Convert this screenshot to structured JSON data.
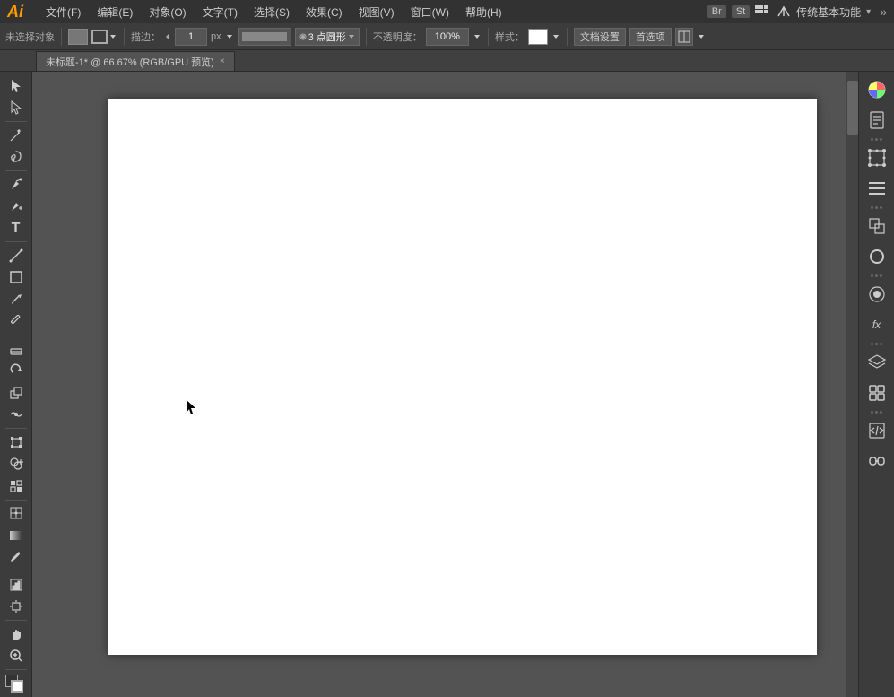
{
  "titlebar": {
    "logo": "Ai",
    "menus": [
      "文件(F)",
      "编辑(E)",
      "对象(O)",
      "文字(T)",
      "选择(S)",
      "效果(C)",
      "视图(V)",
      "窗口(W)",
      "帮助(H)"
    ],
    "bridge_label": "Br",
    "stock_label": "St",
    "workspace_label": "传统基本功能",
    "workspace_arrow": "▾"
  },
  "optionsbar": {
    "no_selection_label": "未选择对象",
    "stroke_label": "描边：",
    "stroke_value": "1",
    "stroke_unit": "px",
    "stroke_dropdown": "3 点圆形",
    "opacity_label": "不透明度：",
    "opacity_value": "100%",
    "style_label": "样式：",
    "doc_settings_label": "文档设置",
    "preferences_label": "首选项"
  },
  "tabbar": {
    "tab_label": "未标题-1* @ 66.67% (RGB/GPU 预览)",
    "close": "×"
  },
  "tools": {
    "selection": "▶",
    "direct_selection": "▷",
    "magic_wand": "✦",
    "lasso": "⌇",
    "pen": "✒",
    "add_anchor": "+",
    "remove_anchor": "−",
    "anchor_convert": "◇",
    "type": "T",
    "line": "/",
    "rect": "□",
    "paintbrush": "⌐",
    "pencil": "✏",
    "blob_brush": "⊙",
    "eraser": "◫",
    "rotate": "↻",
    "scale": "⤢",
    "warp": "≋",
    "width": "⊢",
    "free_transform": "⊡",
    "shape_builder": "⊞",
    "live_paint": "⊟",
    "perspective": "⊗",
    "mesh": "⋈",
    "gradient": "■",
    "eyedropper": "✦",
    "blend": "∞",
    "symbol": "⊕",
    "graph": "▦",
    "artboard": "⊞",
    "slice": "✂",
    "hand": "✋",
    "zoom": "⊕"
  },
  "canvas": {
    "background_color": "#535353",
    "artboard_color": "#ffffff"
  },
  "right_panel": {
    "color_icon": "🎨",
    "document_icon": "📄",
    "transform_icon": "⊞",
    "align_icon": "≡",
    "pathfinder_icon": "⊟",
    "stroke_icon": "○",
    "appearance_icon": "◉",
    "fx_icon": "fx",
    "layers_icon": "◫",
    "links_icon": "⊡",
    "embed_icon": "⊞"
  }
}
